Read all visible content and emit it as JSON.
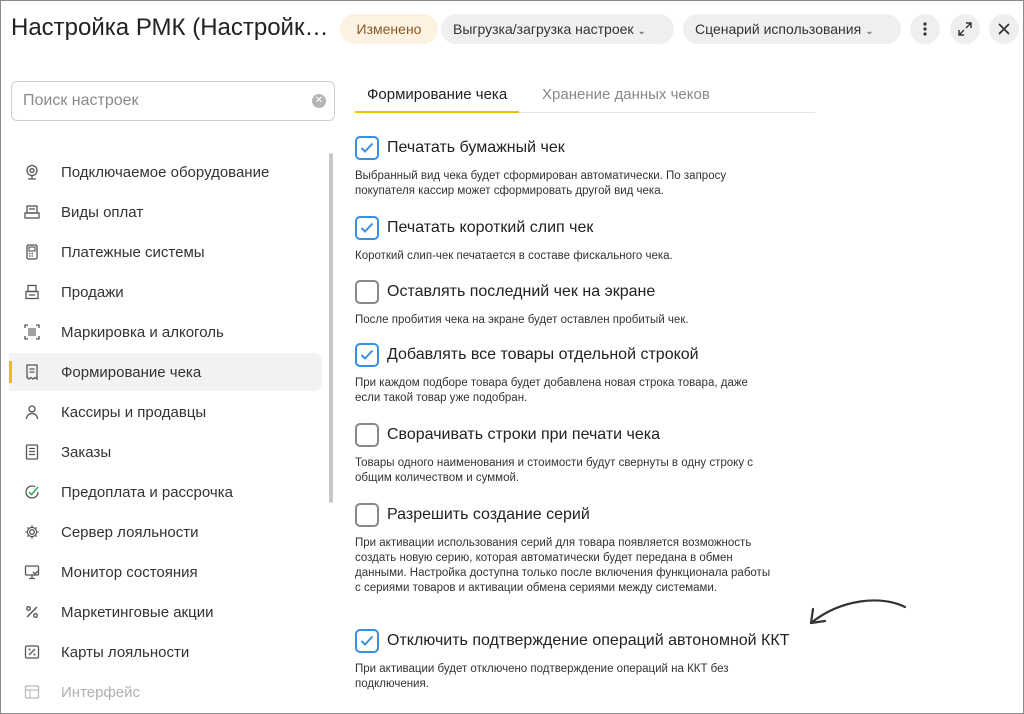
{
  "header": {
    "title": "Настройка РМК (Настройк…",
    "status_badge": "Изменено",
    "export_menu": "Выгрузка/загрузка настроек",
    "scenario_menu": "Сценарий использования"
  },
  "search": {
    "placeholder": "Поиск настроек",
    "value": ""
  },
  "sidebar": {
    "items": [
      {
        "label": "Подключаемое оборудование",
        "icon": "webcam-icon"
      },
      {
        "label": "Виды оплат",
        "icon": "card-terminal-icon"
      },
      {
        "label": "Платежные системы",
        "icon": "pos-terminal-icon"
      },
      {
        "label": "Продажи",
        "icon": "cash-register-icon"
      },
      {
        "label": "Маркировка и алкоголь",
        "icon": "barcode-scan-icon"
      },
      {
        "label": "Формирование чека",
        "icon": "receipt-icon",
        "active": true
      },
      {
        "label": "Кассиры и продавцы",
        "icon": "person-icon"
      },
      {
        "label": "Заказы",
        "icon": "document-list-icon"
      },
      {
        "label": "Предоплата и рассрочка",
        "icon": "check-circle-icon"
      },
      {
        "label": "Сервер лояльности",
        "icon": "gear-icon"
      },
      {
        "label": "Монитор состояния",
        "icon": "monitor-icon"
      },
      {
        "label": "Маркетинговые акции",
        "icon": "percent-icon"
      },
      {
        "label": "Карты лояльности",
        "icon": "percent-card-icon"
      },
      {
        "label": "Интерфейс",
        "icon": "interface-icon"
      }
    ]
  },
  "tabs": [
    {
      "label": "Формирование чека",
      "active": true
    },
    {
      "label": "Хранение данных чеков",
      "active": false
    }
  ],
  "settings": [
    {
      "label": "Печатать бумажный чек",
      "checked": true,
      "desc": "Выбранный вид чека будет сформирован автоматически. По запросу покупателя кассир может сформировать другой вид чека."
    },
    {
      "label": "Печатать короткий слип чек",
      "checked": true,
      "desc": "Короткий слип-чек печатается  в составе фискального чека."
    },
    {
      "label": "Оставлять последний чек на экране",
      "checked": false,
      "desc": "После пробития чека на экране будет оставлен пробитый чек."
    },
    {
      "label": "Добавлять все товары отдельной строкой",
      "checked": true,
      "desc": "При каждом подборе товара будет добавлена новая строка товара, даже если такой товар уже подобран."
    },
    {
      "label": "Сворачивать строки при печати чека",
      "checked": false,
      "desc": "Товары одного наименования и стоимости будут свернуты в одну строку с общим количеством и суммой."
    },
    {
      "label": "Разрешить создание серий",
      "checked": false,
      "desc": "При активации использования серий для товара появляется возможность создать новую серию, которая автоматически будет передана в обмен данными. Настройка доступна только после включения функционала работы с сериями товаров и активации обмена сериями между системами."
    },
    {
      "label": "Отключить подтверждение операций автономной ККТ",
      "checked": true,
      "desc": "При активации будет отключено подтверждение операций на ККТ без подключения."
    }
  ],
  "colors": {
    "accent": "#f0c000",
    "checkbox": "#3b8fe0",
    "badge_bg": "#fdf1e2"
  }
}
